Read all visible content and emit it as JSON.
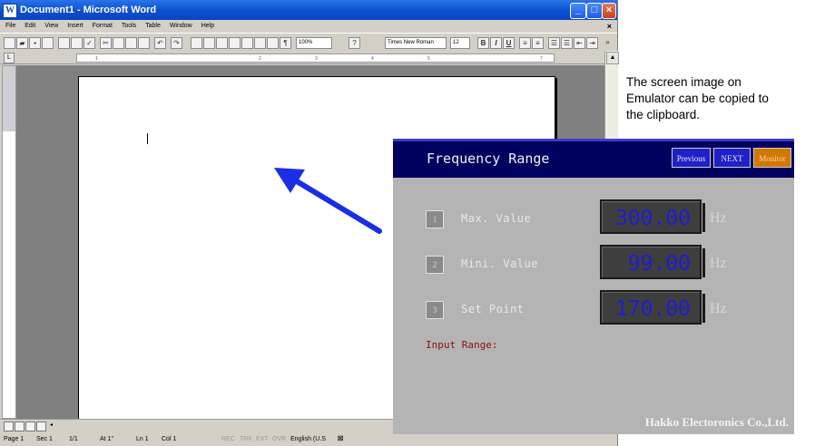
{
  "word": {
    "title": "Document1 - Microsoft Word",
    "menu": [
      "File",
      "Edit",
      "View",
      "Insert",
      "Format",
      "Tools",
      "Table",
      "Window",
      "Help"
    ],
    "zoom": "100%",
    "font": "Times New Roman",
    "font_size": "12",
    "ruler_ticks": [
      "1",
      "2",
      "3",
      "4",
      "5",
      "7"
    ],
    "status": {
      "page": "Page 1",
      "sec": "Sec 1",
      "pages": "1/1",
      "at": "At 1\"",
      "ln": "Ln 1",
      "col": "Col 1",
      "rec": "REC",
      "trk": "TRK",
      "ext": "EXT",
      "ovr": "OVR",
      "lang": "English (U.S"
    }
  },
  "annotation": {
    "lines": [
      "The screen image on",
      "Emulator can be copied to",
      "the clipboard."
    ]
  },
  "emulator": {
    "title": "Frequency Range",
    "buttons": {
      "previous": "Previous",
      "next": "NEXT",
      "monitor": "Monitor"
    },
    "rows": [
      {
        "num": "1",
        "label": "Max. Value",
        "value": "300.00",
        "unit": "Hz"
      },
      {
        "num": "2",
        "label": "Mini. Value",
        "value": "99.00",
        "unit": "Hz"
      },
      {
        "num": "3",
        "label": "Set Point",
        "value": "170.00",
        "unit": "Hz"
      }
    ],
    "input_range": "Input Range:",
    "company": "Hakko Electoronics Co.,Ltd."
  }
}
